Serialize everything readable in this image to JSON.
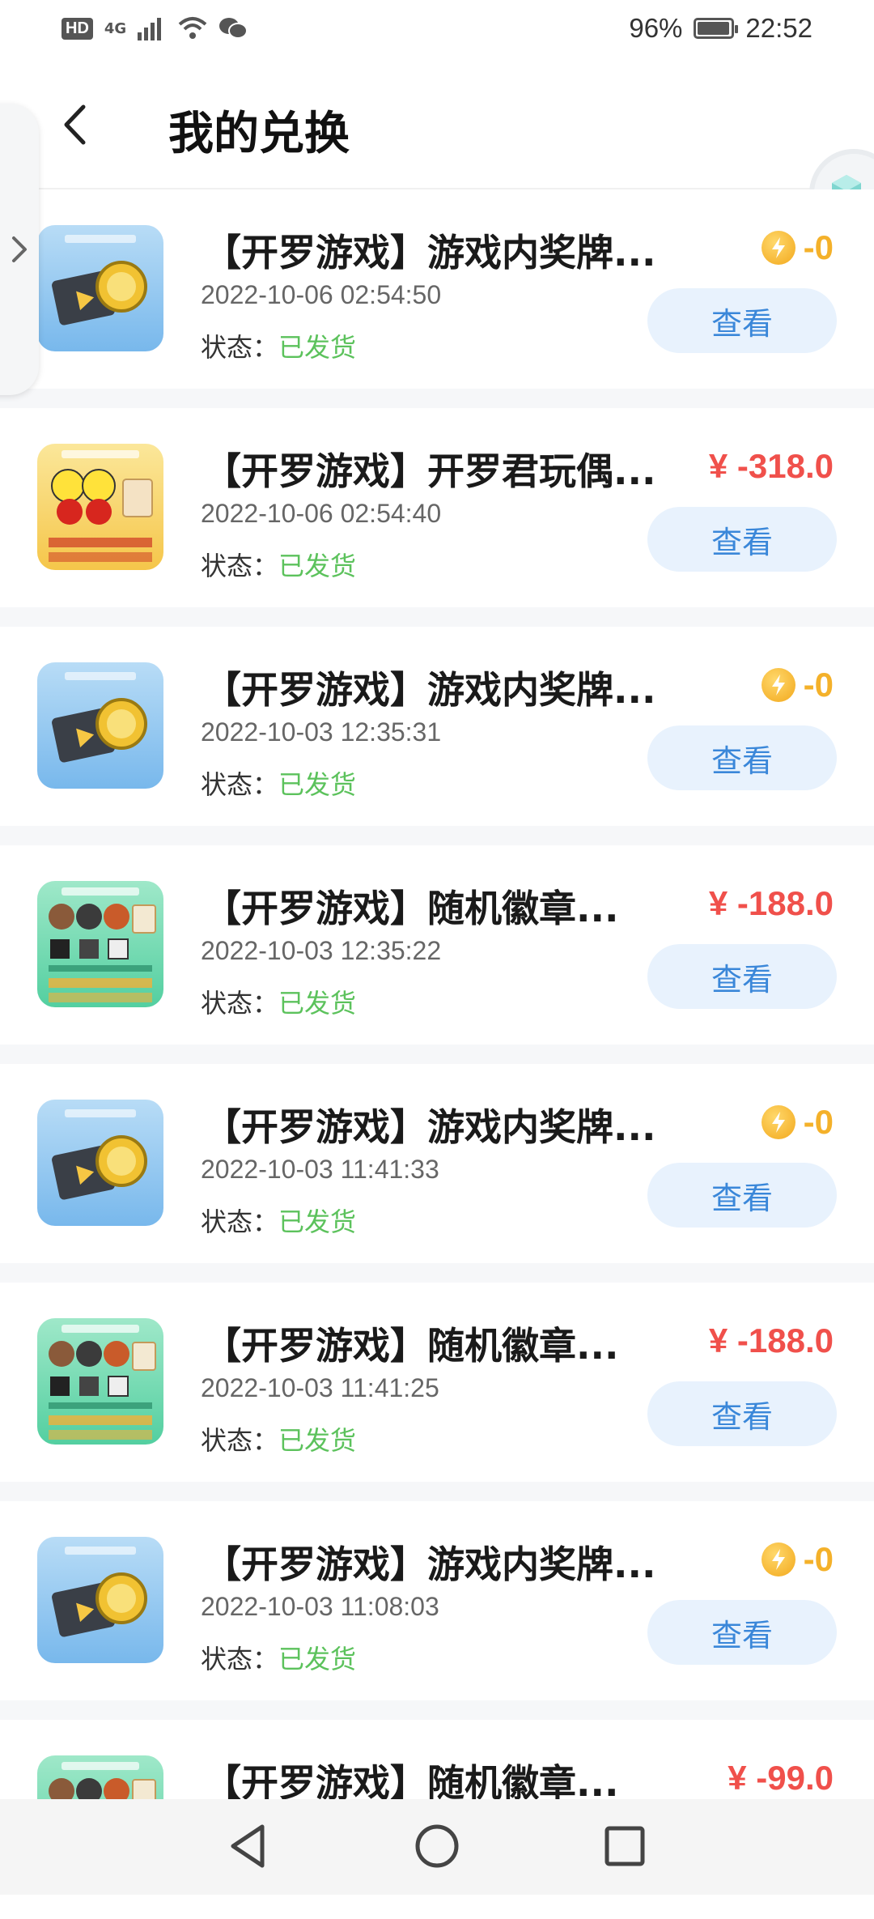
{
  "status_bar": {
    "hd": "HD",
    "network": "4G",
    "battery": "96%",
    "battery_level": 0.96,
    "time": "22:52"
  },
  "header": {
    "title": "我的兑换"
  },
  "status_label": "状态：",
  "view_label": "查看",
  "items": [
    {
      "title": "【开罗游戏】游戏内奖牌...",
      "date": "2022-10-06  02:54:50",
      "status": "已发货",
      "price_type": "coin",
      "price": "-0",
      "thumb": "medal"
    },
    {
      "title": "【开罗游戏】开罗君玩偶...",
      "date": "2022-10-06  02:54:40",
      "status": "已发货",
      "price_type": "cash",
      "price": "¥ -318.0",
      "thumb": "doll"
    },
    {
      "title": "【开罗游戏】游戏内奖牌...",
      "date": "2022-10-03  12:35:31",
      "status": "已发货",
      "price_type": "coin",
      "price": "-0",
      "thumb": "medal"
    },
    {
      "title": "【开罗游戏】随机徽章...",
      "date": "2022-10-03  12:35:22",
      "status": "已发货",
      "price_type": "cash",
      "price": "¥ -188.0",
      "thumb": "badge"
    },
    {
      "title": "【开罗游戏】游戏内奖牌...",
      "date": "2022-10-03  11:41:33",
      "status": "已发货",
      "price_type": "coin",
      "price": "-0",
      "thumb": "medal"
    },
    {
      "title": "【开罗游戏】随机徽章...",
      "date": "2022-10-03  11:41:25",
      "status": "已发货",
      "price_type": "cash",
      "price": "¥ -188.0",
      "thumb": "badge"
    },
    {
      "title": "【开罗游戏】游戏内奖牌...",
      "date": "2022-10-03  11:08:03",
      "status": "已发货",
      "price_type": "coin",
      "price": "-0",
      "thumb": "medal"
    },
    {
      "title": "【开罗游戏】随机徽章...",
      "date": "",
      "status": "",
      "price_type": "cash",
      "price": "¥ -99.0",
      "thumb": "badge"
    }
  ],
  "colors": {
    "cash": "#f0504b",
    "coin": "#f4b12a",
    "status_ok": "#5cc25c",
    "view_button_bg": "#e8f2fd",
    "view_button_text": "#3a87d9"
  },
  "icons": [
    "back-icon",
    "chevron-right-icon",
    "coin-icon",
    "nav-back-icon",
    "nav-home-icon",
    "nav-recents-icon",
    "wifi-icon",
    "wechat-icon",
    "battery-icon",
    "cube-icon"
  ]
}
